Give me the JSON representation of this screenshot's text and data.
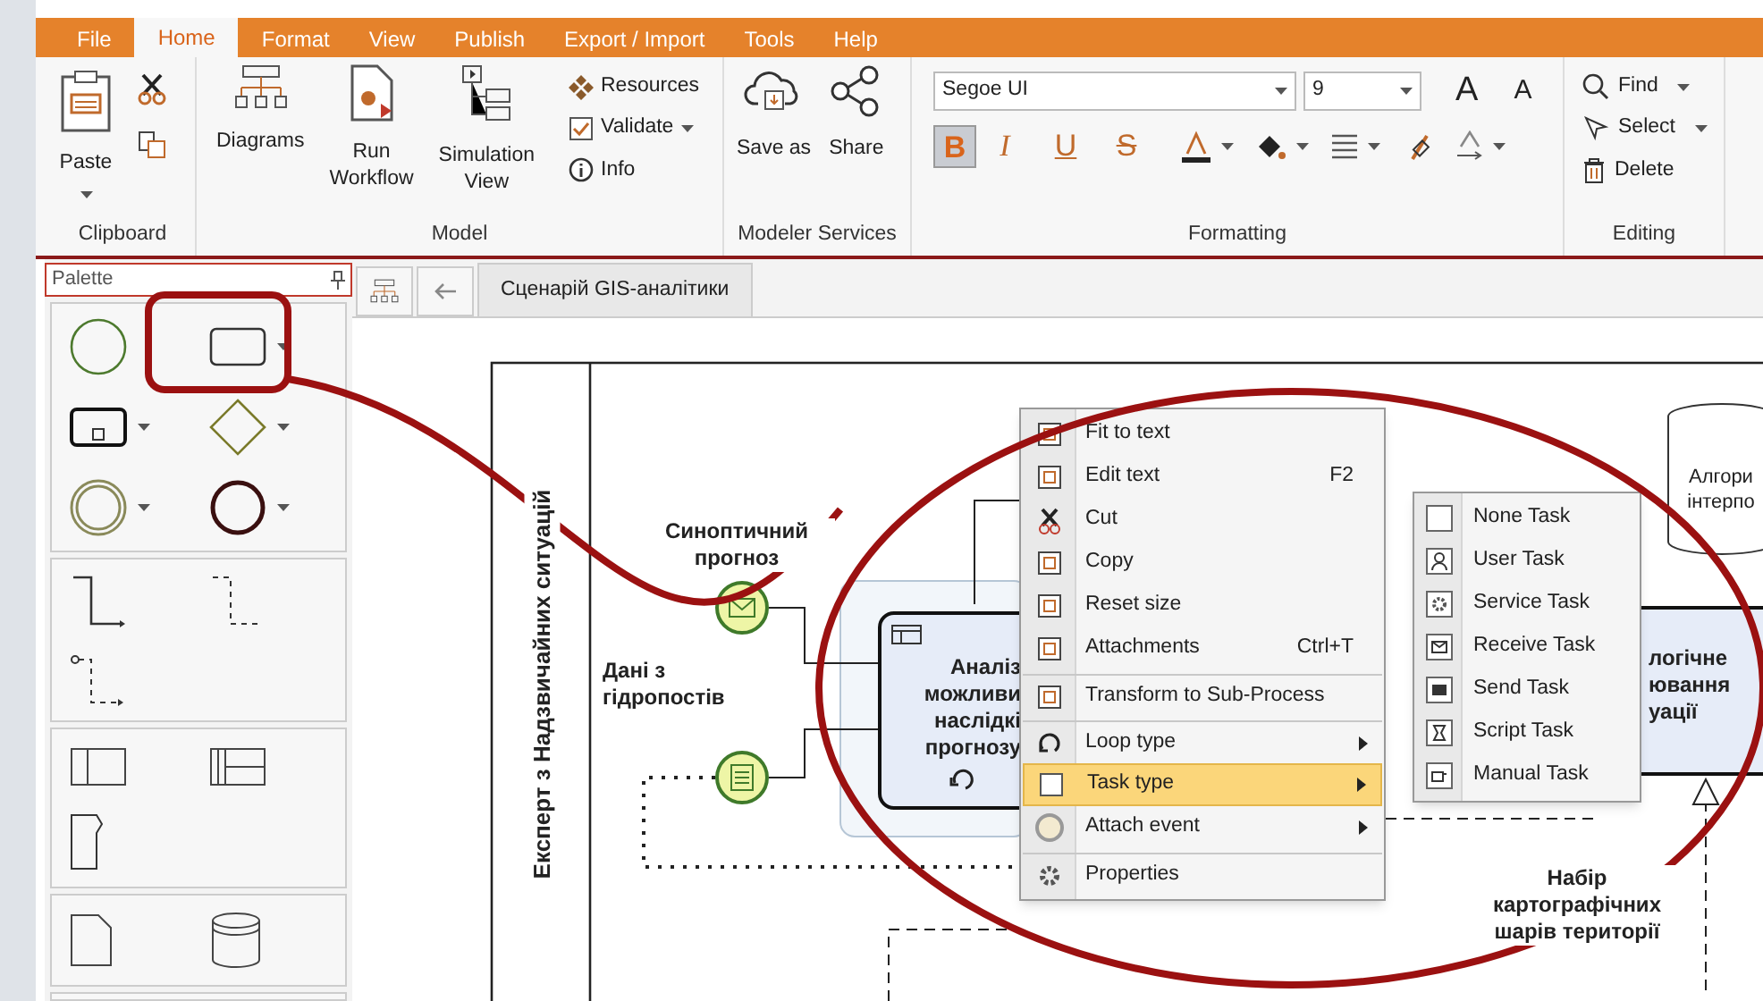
{
  "menu_tabs": [
    {
      "label": "File",
      "selected": false
    },
    {
      "label": "Home",
      "selected": true
    },
    {
      "label": "Format",
      "selected": false
    },
    {
      "label": "View",
      "selected": false
    },
    {
      "label": "Publish",
      "selected": false
    },
    {
      "label": "Export / Import",
      "selected": false
    },
    {
      "label": "Tools",
      "selected": false
    },
    {
      "label": "Help",
      "selected": false
    }
  ],
  "ribbon": {
    "clipboard": {
      "label": "Clipboard",
      "paste": "Paste"
    },
    "model": {
      "label": "Model",
      "large": [
        "Diagrams",
        "Run Workflow",
        "Simulation View"
      ],
      "small": [
        {
          "label": "Resources",
          "dropdown": false
        },
        {
          "label": "Validate",
          "dropdown": true
        },
        {
          "label": "Info",
          "dropdown": false
        }
      ]
    },
    "services": {
      "label": "Modeler Services",
      "large": [
        "Save as",
        "Share"
      ]
    },
    "formatting": {
      "label": "Formatting",
      "font": "Segoe UI",
      "size": "9",
      "grow": "A",
      "shrink": "A",
      "styles": [
        {
          "label": "B",
          "selected": true
        },
        {
          "label": "I",
          "selected": false
        },
        {
          "label": "U",
          "selected": false
        },
        {
          "label": "S",
          "selected": false
        }
      ],
      "tools": [
        {
          "dropdown": true
        },
        {
          "dropdown": true
        },
        {
          "dropdown": true
        },
        {
          "dropdown": false
        },
        {
          "dropdown": true
        }
      ]
    },
    "editing": {
      "label": "Editing",
      "items": [
        {
          "label": "Find",
          "dropdown": true
        },
        {
          "label": "Select",
          "dropdown": true
        },
        {
          "label": "Delete",
          "dropdown": false
        }
      ]
    }
  },
  "palette": {
    "title": "Palette"
  },
  "doc_tabs": [
    {
      "label": "Сценарій GIS-аналітики",
      "selected": true
    }
  ],
  "diagram": {
    "lane": "Експерт з Надзвичайних ситуацій",
    "labels": [
      "Синоптичний прогноз",
      "Дані з гідропостів",
      "Набір картографічних шарів території"
    ],
    "task_lines": [
      "Аналіз",
      "можливи",
      "наслідкі",
      "прогнозу"
    ],
    "right_task_lines": [
      "логічне",
      "ювання",
      "уації"
    ],
    "store_lines": [
      "Алгори",
      "інтерпо"
    ]
  },
  "context_menu": [
    {
      "label": "Fit to text",
      "separator_before": false,
      "submenu": false,
      "selected": false
    },
    {
      "label": "Edit text",
      "shortcut": "F2",
      "separator_before": false,
      "submenu": false,
      "selected": false
    },
    {
      "label": "Cut",
      "separator_before": false,
      "submenu": false,
      "selected": false
    },
    {
      "label": "Copy",
      "separator_before": false,
      "submenu": false,
      "selected": false
    },
    {
      "label": "Reset size",
      "separator_before": false,
      "submenu": false,
      "selected": false
    },
    {
      "label": "Attachments",
      "shortcut": "Ctrl+T",
      "separator_before": false,
      "submenu": false,
      "selected": false
    },
    {
      "label": "Transform to Sub-Process",
      "separator_before": true,
      "submenu": false,
      "selected": false
    },
    {
      "label": "Loop type",
      "separator_before": true,
      "submenu": true,
      "selected": false
    },
    {
      "label": "Task type",
      "separator_before": false,
      "submenu": true,
      "selected": true
    },
    {
      "label": "Attach event",
      "separator_before": false,
      "submenu": true,
      "selected": false
    },
    {
      "label": "Properties",
      "separator_before": true,
      "submenu": false,
      "selected": false
    }
  ],
  "submenu": [
    "None Task",
    "User Task",
    "Service Task",
    "Receive Task",
    "Send Task",
    "Script Task",
    "Manual Task"
  ]
}
